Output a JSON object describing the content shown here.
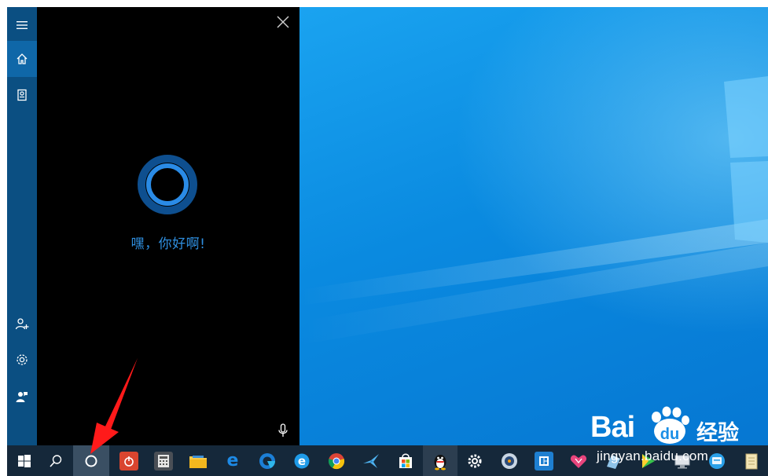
{
  "cortana": {
    "greeting": "嘿，你好啊!",
    "accent_color": "#1e7fd8",
    "rail": {
      "top_items": [
        "menu-icon",
        "home-icon",
        "notebook-icon"
      ],
      "bottom_items": [
        "add-user-icon",
        "settings-icon",
        "feedback-icon"
      ],
      "active_item": "home-icon"
    },
    "close_icon": "close-icon",
    "mic_icon": "microphone-icon"
  },
  "taskbar": {
    "start_icon": "windows-start-icon",
    "search_icon": "search-icon",
    "cortana_icon": "cortana-circle-icon",
    "apps": [
      "power-app",
      "calculator",
      "file-explorer",
      "microsoft-edge",
      "edge-beta",
      "internet-explorer",
      "google-chrome",
      "bird-app",
      "microsoft-store",
      "qq",
      "settings",
      "media-app",
      "office-app",
      "pink-app",
      "blue-app",
      "video-player",
      "remote-app",
      "disk-app",
      "notepad"
    ]
  },
  "watermark": {
    "brand": "Bai",
    "brand_suffix": "经验",
    "url": "jingyan.baidu.com"
  },
  "colors": {
    "rail": "#0b4f82",
    "panel": "#000000",
    "taskbar": "#15283a",
    "desktop": "#0a8ae0",
    "annotation": "#ff1a1a"
  }
}
